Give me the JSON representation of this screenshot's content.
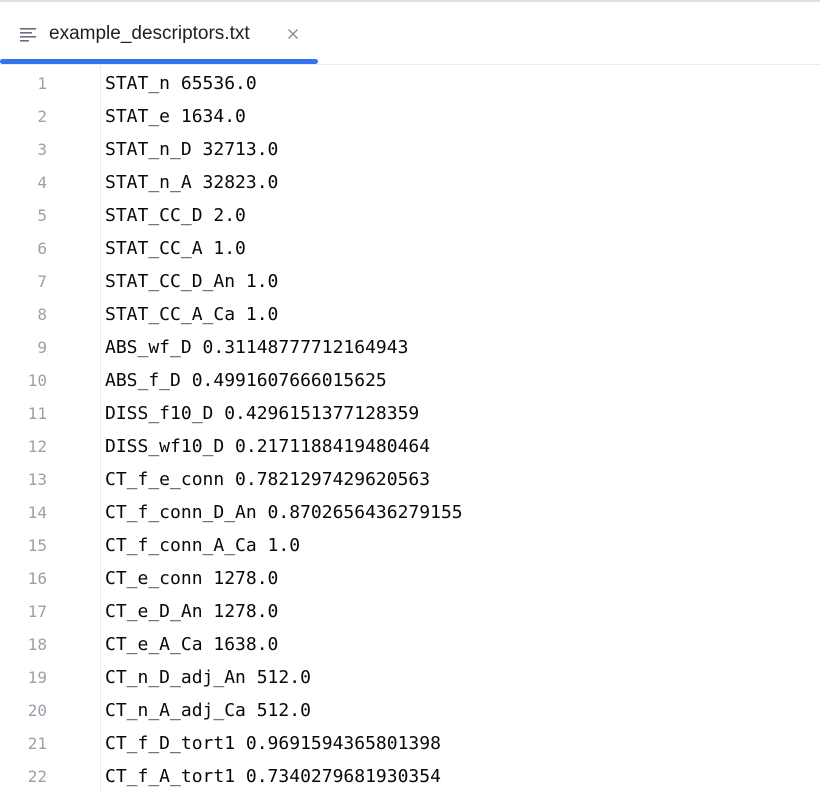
{
  "tab": {
    "title": "example_descriptors.txt",
    "icon": "text-file-icon",
    "close_icon": "close-icon",
    "accent": "#3574f0"
  },
  "editor": {
    "lines": [
      {
        "num": "1",
        "text": "STAT_n 65536.0"
      },
      {
        "num": "2",
        "text": "STAT_e 1634.0"
      },
      {
        "num": "3",
        "text": "STAT_n_D 32713.0"
      },
      {
        "num": "4",
        "text": "STAT_n_A 32823.0"
      },
      {
        "num": "5",
        "text": "STAT_CC_D 2.0"
      },
      {
        "num": "6",
        "text": "STAT_CC_A 1.0"
      },
      {
        "num": "7",
        "text": "STAT_CC_D_An 1.0"
      },
      {
        "num": "8",
        "text": "STAT_CC_A_Ca 1.0"
      },
      {
        "num": "9",
        "text": "ABS_wf_D 0.31148777712164943"
      },
      {
        "num": "10",
        "text": "ABS_f_D 0.4991607666015625"
      },
      {
        "num": "11",
        "text": "DISS_f10_D 0.4296151377128359"
      },
      {
        "num": "12",
        "text": "DISS_wf10_D 0.2171188419480464"
      },
      {
        "num": "13",
        "text": "CT_f_e_conn 0.7821297429620563"
      },
      {
        "num": "14",
        "text": "CT_f_conn_D_An 0.8702656436279155"
      },
      {
        "num": "15",
        "text": "CT_f_conn_A_Ca 1.0"
      },
      {
        "num": "16",
        "text": "CT_e_conn 1278.0"
      },
      {
        "num": "17",
        "text": "CT_e_D_An 1278.0"
      },
      {
        "num": "18",
        "text": "CT_e_A_Ca 1638.0"
      },
      {
        "num": "19",
        "text": "CT_n_D_adj_An 512.0"
      },
      {
        "num": "20",
        "text": "CT_n_A_adj_Ca 512.0"
      },
      {
        "num": "21",
        "text": "CT_f_D_tort1 0.9691594365801398"
      },
      {
        "num": "22",
        "text": "CT_f_A_tort1 0.7340279681930354"
      }
    ]
  }
}
